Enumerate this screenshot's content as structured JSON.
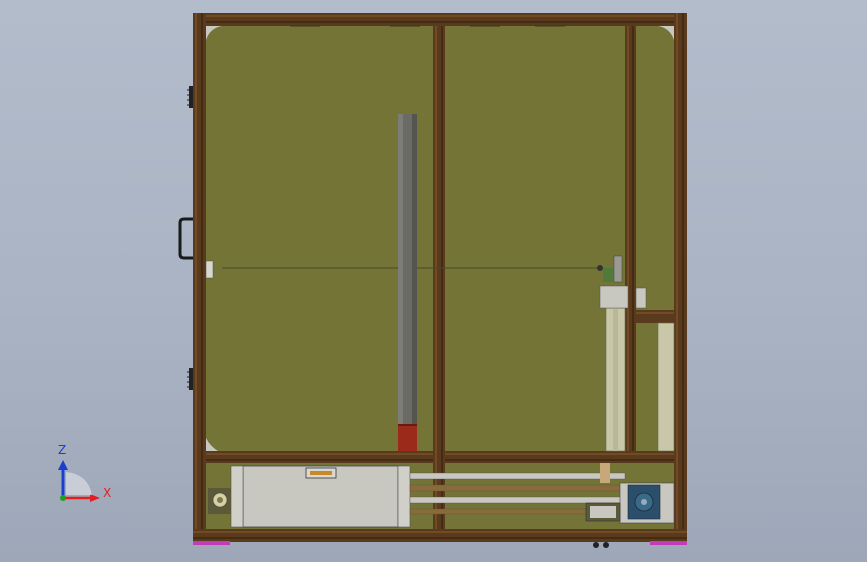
{
  "viewport": {
    "background_top": "#b3bccb",
    "background_bottom": "#9da7b8"
  },
  "colors": {
    "frame": "#5a3a1c",
    "frame_highlight": "#8b5a2b",
    "panel": "#737436",
    "panel_dark": "#6a6b31",
    "column": "#6b6b66",
    "column_base": "#9b2a1a",
    "machine_grey": "#c8c8c0",
    "foot_magenta": "#c23bb8",
    "motor_blue": "#2b4f6b",
    "axis_x": "#e02020",
    "axis_y": "#20a020",
    "axis_z": "#1a3fd0"
  },
  "triad": {
    "z_label": "Z",
    "x_label": "X"
  },
  "icons": {
    "handle": "door-handle-icon",
    "hinge": "hinge-icon",
    "motor": "servo-motor-icon",
    "triad": "coordinate-triad-icon"
  }
}
